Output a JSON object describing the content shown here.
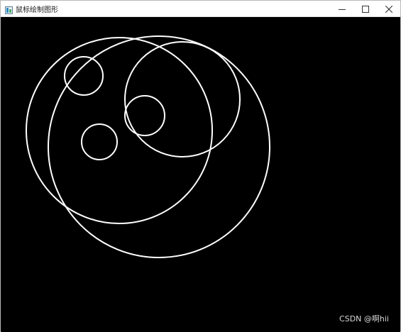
{
  "window": {
    "title": "鼠标绘制图形",
    "app_icon": "opencv-window-icon",
    "controls": [
      {
        "name": "minimize",
        "icon": "minimize-icon"
      },
      {
        "name": "maximize",
        "icon": "maximize-icon"
      },
      {
        "name": "close",
        "icon": "close-icon"
      }
    ]
  },
  "canvas": {
    "background": "#000000",
    "stroke_color": "#ffffff"
  },
  "watermark": {
    "text": "CSDN @啊hii"
  }
}
